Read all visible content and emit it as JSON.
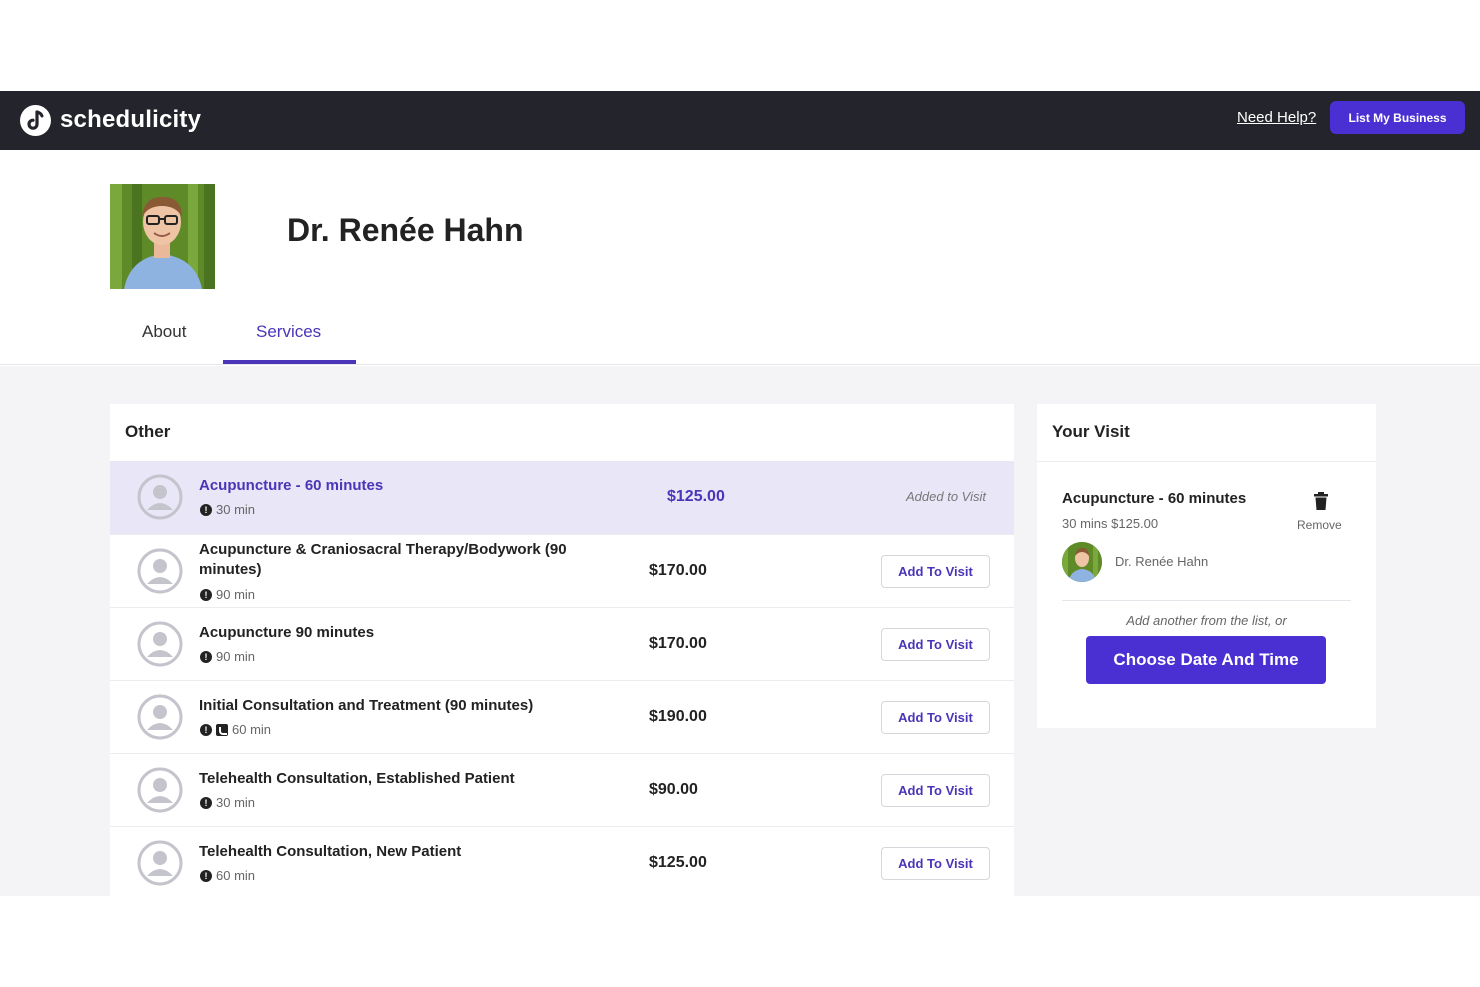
{
  "nav": {
    "brand": "schedulicity",
    "help_link": "Need Help?",
    "list_button": "List My Business"
  },
  "profile": {
    "name": "Dr. Renée Hahn",
    "tabs": [
      {
        "label": "About",
        "active": false
      },
      {
        "label": "Services",
        "active": true
      }
    ]
  },
  "services": {
    "category": "Other",
    "items": [
      {
        "name": "Acupuncture - 60 minutes",
        "duration": "30 min",
        "price": "$125.00",
        "status": "Added to Visit",
        "selected": true
      },
      {
        "name": "Acupuncture & Craniosacral Therapy/Bodywork (90 minutes)",
        "duration": "90 min",
        "price": "$170.00",
        "action": "Add To Visit"
      },
      {
        "name": "Acupuncture 90 minutes",
        "duration": "90 min",
        "price": "$170.00",
        "action": "Add To Visit"
      },
      {
        "name": "Initial Consultation and Treatment (90 minutes)",
        "duration": "60 min",
        "price": "$190.00",
        "action": "Add To Visit",
        "has_phone_icon": true
      },
      {
        "name": "Telehealth Consultation, Established Patient",
        "duration": "30 min",
        "price": "$90.00",
        "action": "Add To Visit"
      },
      {
        "name": "Telehealth Consultation, New Patient",
        "duration": "60 min",
        "price": "$125.00",
        "action": "Add To Visit"
      }
    ]
  },
  "visit": {
    "title": "Your Visit",
    "service_name": "Acupuncture - 60 minutes",
    "service_meta": "30 mins $125.00",
    "remove_label": "Remove",
    "provider": "Dr. Renée Hahn",
    "add_another": "Add another from the list, or",
    "choose_button": "Choose Date And Time"
  },
  "colors": {
    "accent": "#4a2fd3",
    "nav_bg": "#24252c",
    "selected_row_bg": "#e9e6f8"
  }
}
